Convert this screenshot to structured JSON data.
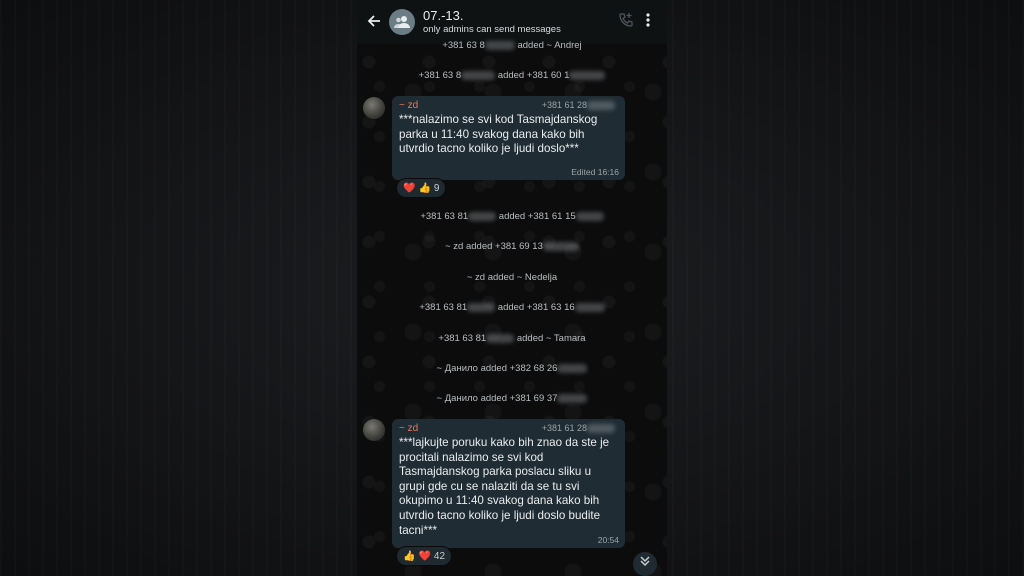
{
  "header": {
    "title": "07.-13.",
    "subtitle": "only admins can send messages"
  },
  "system_messages": [
    {
      "a": "+381 63 8",
      "b": " added ~ Andrej"
    },
    {
      "a": "+381 63 8",
      "b": " added +381 60 1"
    },
    {
      "a": "+381 63 81",
      "b": " added +381 61 15"
    },
    {
      "a": "~ zd added +381 69 13",
      "b": ""
    },
    {
      "a": "~ zd added ~ Nedelja",
      "b": ""
    },
    {
      "a": "+381 63 81",
      "b": " added +381 63 16"
    },
    {
      "a": "+381 63 81",
      "b": " added ~ Tamara"
    },
    {
      "a": "~ Данило added +382 68 26",
      "b": ""
    },
    {
      "a": "~ Данило added +381 69 37",
      "b": ""
    }
  ],
  "messages": [
    {
      "sender": "~ zd",
      "phone": "+381 61 28",
      "text": "***nalazimo se svi kod Tasmajdanskog parka u 11:40 svakog dana kako bih utvrdio tacno koliko je ljudi doslo***",
      "meta": "Edited 16:16",
      "reactions": {
        "emoji1": "❤️",
        "emoji2": "👍",
        "count": "9"
      }
    },
    {
      "sender": "~ zd",
      "phone": "+381 61 28",
      "text": "***lajkujte poruku kako bih znao da ste je procitali nalazimo se svi kod Tasmajdanskog parka poslacu sliku u grupi gde cu se nalaziti da se tu svi okupimo u 11:40 svakog dana kako bih utvrdio tacno koliko je ljudi doslo budite tacni***",
      "meta": "20:54",
      "reactions": {
        "emoji1": "👍",
        "emoji2": "❤️",
        "count": "42"
      }
    }
  ],
  "icons": {
    "back": "arrow-left-icon",
    "group_avatar": "group-people-icon",
    "add_call": "add-call-icon",
    "menu": "more-vert-icon",
    "scroll": "chevrons-down-icon"
  },
  "colors": {
    "sender_name": "#e5795e",
    "bubble": "#202c33",
    "header": "#0f1213"
  }
}
